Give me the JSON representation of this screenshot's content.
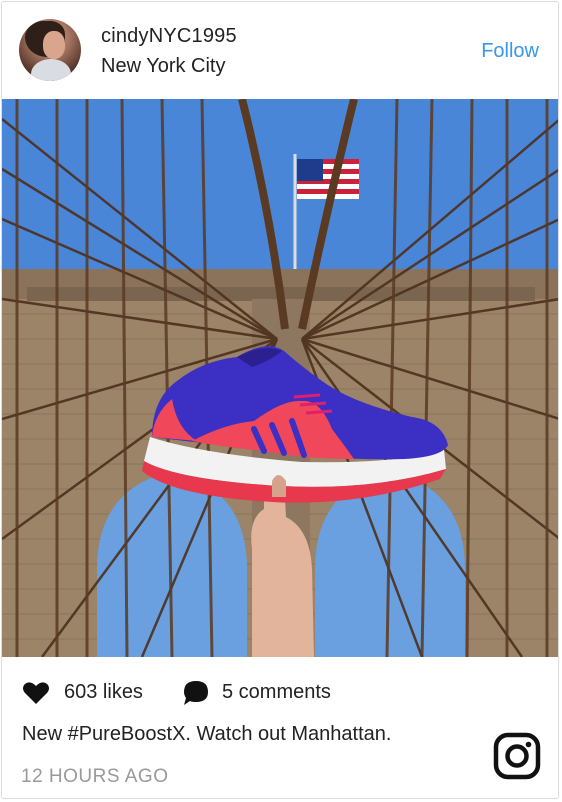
{
  "post": {
    "author": {
      "username": "cindyNYC1995",
      "location": "New York City",
      "avatar": "avatar-photo"
    },
    "follow_label": "Follow",
    "image": {
      "subject": "bridge-photo"
    },
    "likes": "603 likes",
    "comments": "5 comments",
    "caption": "New #PureBoostX. Watch out Manhattan.",
    "timestamp": "12 HOURS AGO"
  },
  "icons": {
    "like": "heart-icon",
    "comment": "comment-bubble-icon",
    "brand": "instagram-icon"
  },
  "colors": {
    "follow": "#3897f0",
    "text": "#222222",
    "muted": "#999999",
    "shoe_upper": "#3b2fc4",
    "shoe_accent": "#f0485a"
  }
}
